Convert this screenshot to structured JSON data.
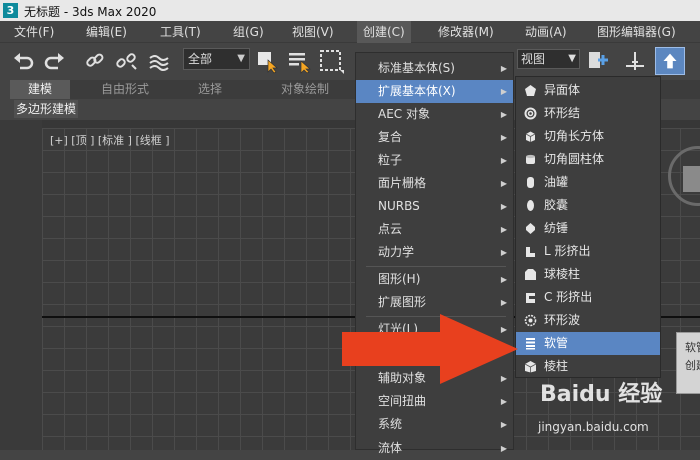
{
  "window": {
    "title": "无标题 - 3ds Max 2020",
    "app_logo": "3"
  },
  "menubar": {
    "items": [
      {
        "label": "文件(F)"
      },
      {
        "label": "编辑(E)"
      },
      {
        "label": "工具(T)"
      },
      {
        "label": "组(G)"
      },
      {
        "label": "视图(V)"
      },
      {
        "label": "创建(C)"
      },
      {
        "label": "修改器(M)"
      },
      {
        "label": "动画(A)"
      },
      {
        "label": "图形编辑器(G)"
      }
    ],
    "active_index": 5
  },
  "toolbar": {
    "selection_filter": "全部",
    "view_dropdown": "视图",
    "icons": [
      "undo-icon",
      "redo-icon",
      "link-icon",
      "unlink-icon",
      "bind-spacewarp-icon",
      "select-object-icon",
      "select-by-name-icon",
      "rect-selection-icon",
      "add-icon",
      "move-pivot-icon",
      "active-icon"
    ]
  },
  "ribbon": {
    "tabs": [
      {
        "label": "建模"
      },
      {
        "label": "自由形式"
      },
      {
        "label": "选择"
      },
      {
        "label": "对象绘制"
      }
    ],
    "active_tab": 0,
    "sub_label": "多边形建模"
  },
  "viewport": {
    "label": "[+] [顶 ] [标准 ] [线框 ]"
  },
  "create_menu": {
    "items": [
      {
        "label": "标准基本体(S)",
        "has_sub": true
      },
      {
        "label": "扩展基本体(X)",
        "has_sub": true,
        "highlighted": true
      },
      {
        "label": "AEC 对象",
        "has_sub": true
      },
      {
        "label": "复合",
        "has_sub": true
      },
      {
        "label": "粒子",
        "has_sub": true
      },
      {
        "label": "面片栅格",
        "has_sub": true
      },
      {
        "label": "NURBS",
        "has_sub": true
      },
      {
        "label": "点云",
        "has_sub": true
      },
      {
        "label": "动力学",
        "has_sub": true
      },
      {
        "label": "图形(H)",
        "has_sub": true
      },
      {
        "label": "扩展图形",
        "has_sub": true
      },
      {
        "label": "灯光(L)",
        "has_sub": true
      },
      {
        "label": "",
        "has_sub": true
      },
      {
        "label": "辅助对象",
        "has_sub": true
      },
      {
        "label": "空间扭曲",
        "has_sub": true
      },
      {
        "label": "系统",
        "has_sub": true
      },
      {
        "label": "流体",
        "has_sub": true
      }
    ]
  },
  "extended_primitives_menu": {
    "items": [
      {
        "label": "异面体",
        "icon": "hedra-icon"
      },
      {
        "label": "环形结",
        "icon": "torus-knot-icon"
      },
      {
        "label": "切角长方体",
        "icon": "chamfer-box-icon"
      },
      {
        "label": "切角圆柱体",
        "icon": "chamfer-cylinder-icon"
      },
      {
        "label": "油罐",
        "icon": "oil-tank-icon"
      },
      {
        "label": "胶囊",
        "icon": "capsule-icon"
      },
      {
        "label": "纺锤",
        "icon": "spindle-icon"
      },
      {
        "label": "L 形挤出",
        "icon": "l-ext-icon"
      },
      {
        "label": "球棱柱",
        "icon": "gengon-icon"
      },
      {
        "label": "C 形挤出",
        "icon": "c-ext-icon"
      },
      {
        "label": "环形波",
        "icon": "ring-wave-icon"
      },
      {
        "label": "软管",
        "icon": "hose-icon",
        "highlighted": true
      },
      {
        "label": "棱柱",
        "icon": "prism-icon"
      }
    ]
  },
  "tooltip": {
    "line1": "软管",
    "line2": "创建"
  },
  "watermark": {
    "brand": "Baidu 经验",
    "url": "jingyan.baidu.com"
  },
  "colors": {
    "highlight": "#5a86c3",
    "arrow": "#e8401e",
    "background": "#444444"
  }
}
